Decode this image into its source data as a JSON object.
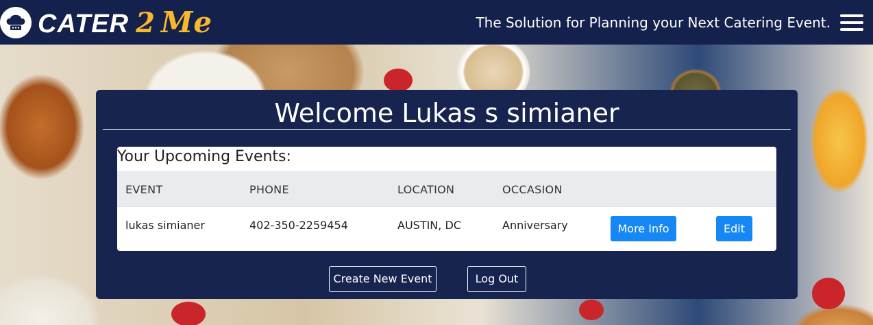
{
  "header": {
    "brand_main": "CATER",
    "brand_two": "2",
    "brand_me": "Me",
    "tagline": "The Solution for Planning your Next Catering Event.",
    "menu_icon": "hamburger-menu-icon",
    "logo_icon": "chef-hat-icon"
  },
  "panel": {
    "welcome": "Welcome Lukas s simianer",
    "events_title": "Your Upcoming Events:",
    "columns": [
      "EVENT",
      "PHONE",
      "LOCATION",
      "OCCASION"
    ],
    "rows": [
      {
        "event": "lukas simianer",
        "phone": "402-350-2259454",
        "location": "AUSTIN, DC",
        "occasion": "Anniversary",
        "more_info_label": "More Info",
        "edit_label": "Edit"
      }
    ],
    "create_label": "Create New Event",
    "logout_label": "Log Out"
  },
  "colors": {
    "header_bg": "#15214d",
    "panel_bg": "#17244f",
    "brand_accent": "#f7b92a",
    "primary_button": "#1688f5"
  }
}
